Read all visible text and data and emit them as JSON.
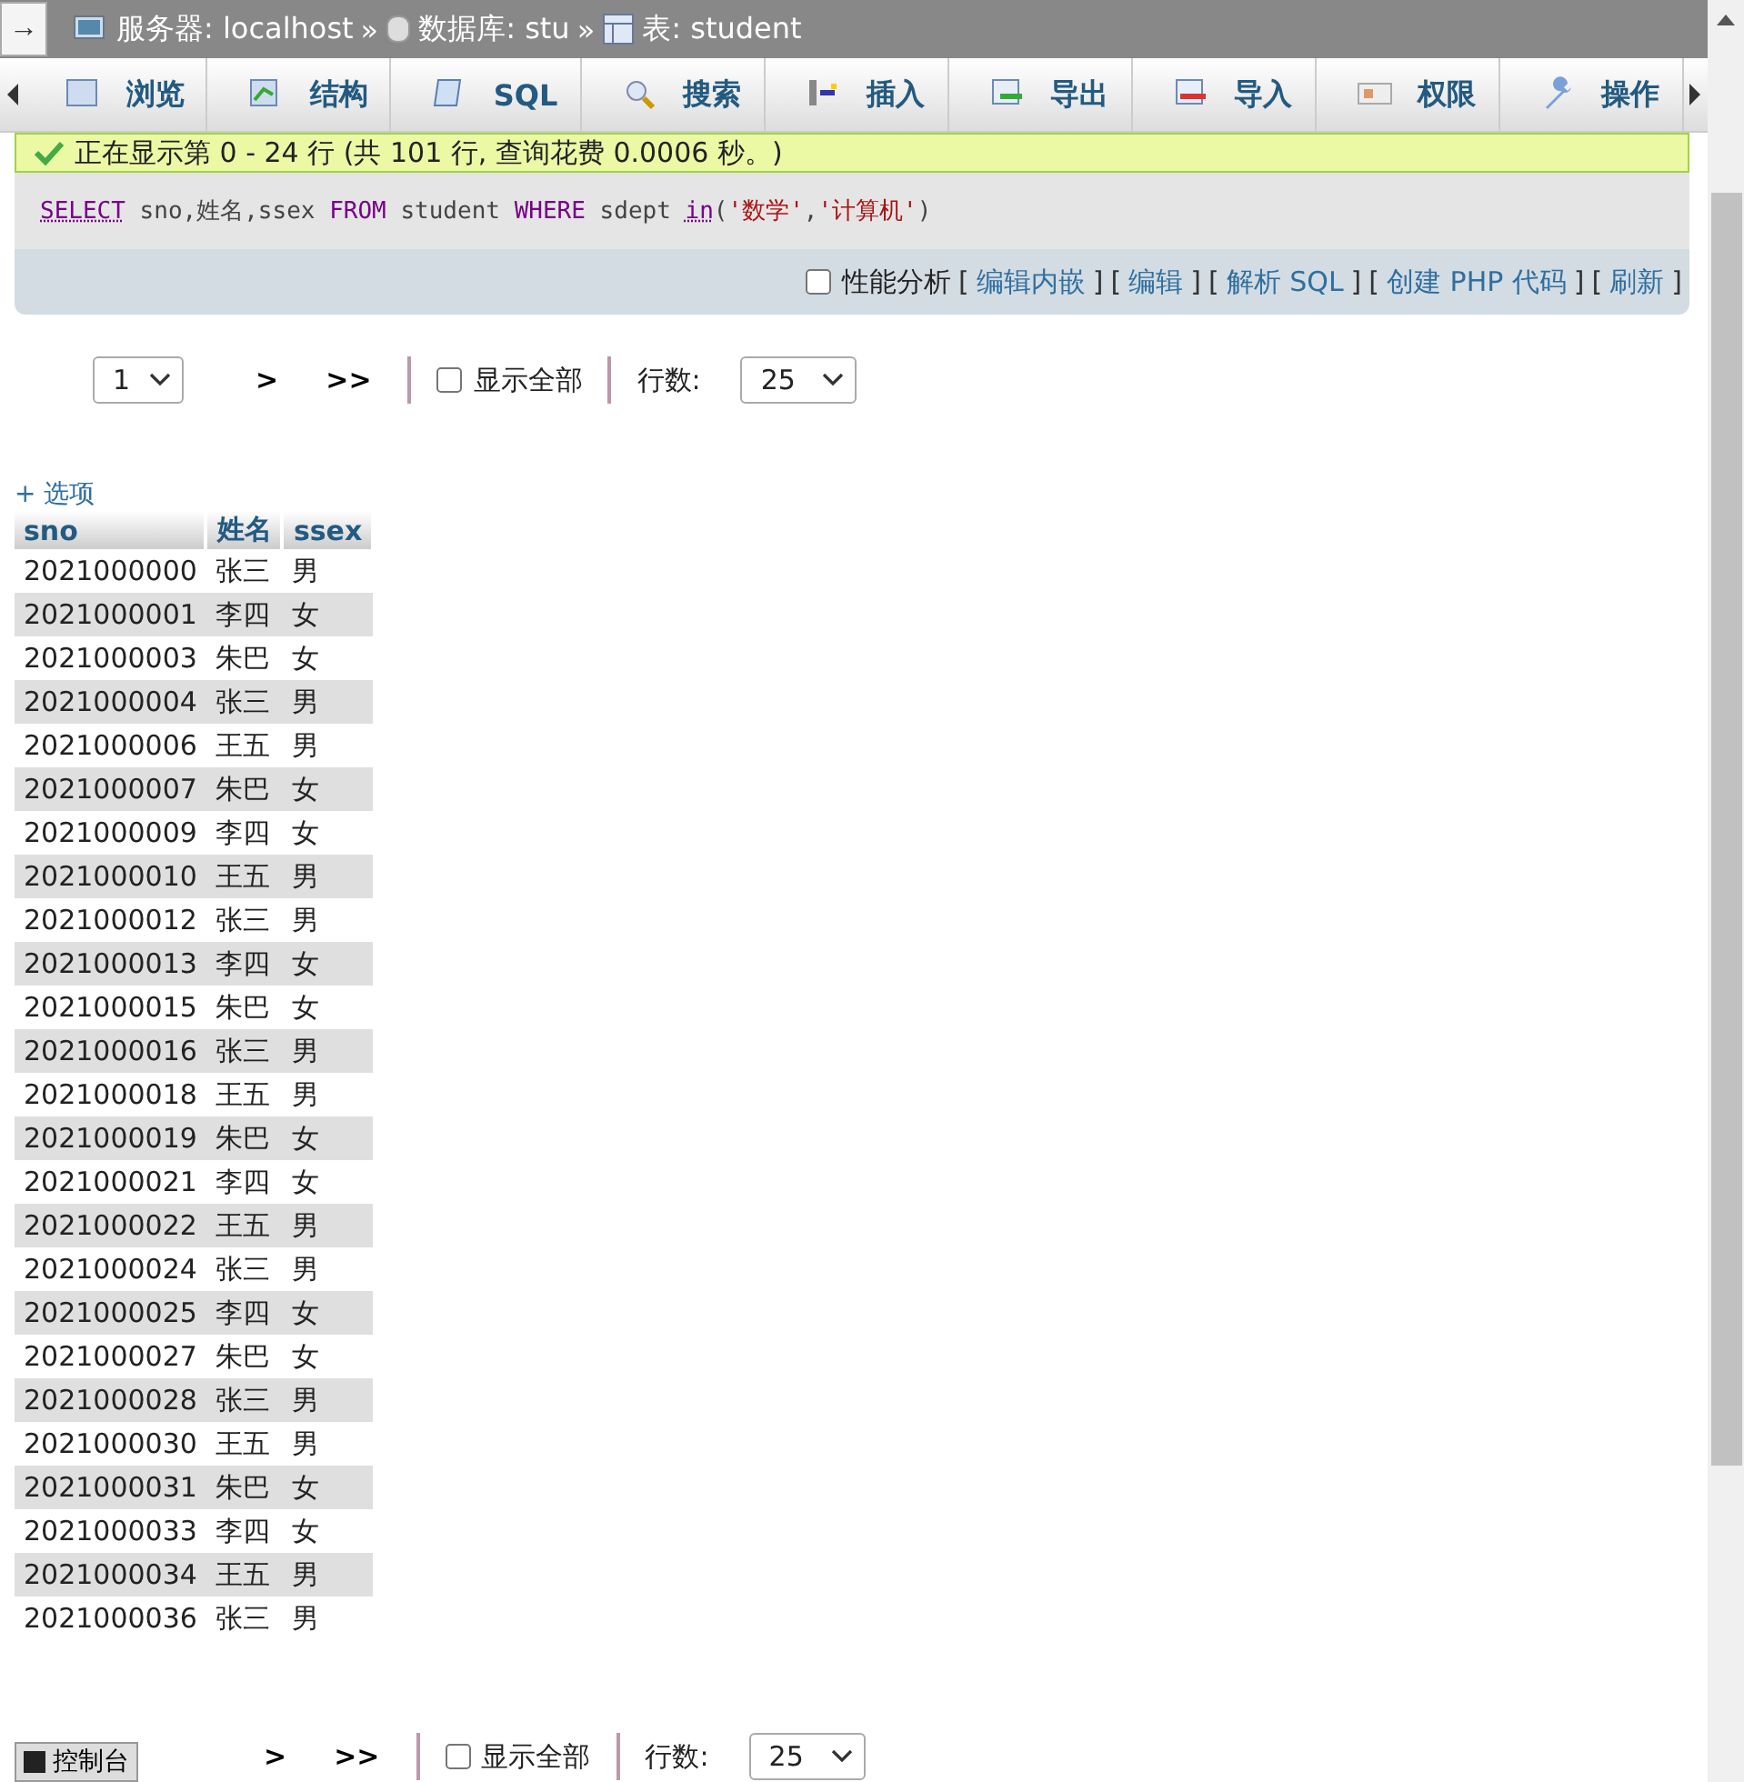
{
  "breadcrumb": [
    {
      "kind": "server",
      "label": "服务器: localhost"
    },
    {
      "kind": "database",
      "label": "数据库: stu"
    },
    {
      "kind": "table",
      "label": "表: student"
    }
  ],
  "breadcrumb_separator": "»",
  "nav_arrow": "→",
  "tabs": [
    {
      "kind": "browse",
      "label": "浏览"
    },
    {
      "kind": "structure",
      "label": "结构"
    },
    {
      "kind": "sql",
      "label": "SQL"
    },
    {
      "kind": "search",
      "label": "搜索"
    },
    {
      "kind": "insert",
      "label": "插入"
    },
    {
      "kind": "export",
      "label": "导出"
    },
    {
      "kind": "import",
      "label": "导入"
    },
    {
      "kind": "privileges",
      "label": "权限"
    },
    {
      "kind": "operations",
      "label": "操作"
    }
  ],
  "notice": "正在显示第 0 - 24 行 (共 101 行, 查询花费 0.0006 秒。)",
  "sql": [
    {
      "kind": "keyword",
      "text": "SELECT"
    },
    {
      "kind": "plain",
      "text": " sno,姓名,ssex "
    },
    {
      "kind": "keyword2",
      "text": "FROM"
    },
    {
      "kind": "plain",
      "text": " student "
    },
    {
      "kind": "keyword2",
      "text": "WHERE"
    },
    {
      "kind": "plain",
      "text": " sdept "
    },
    {
      "kind": "keyword",
      "text": "in"
    },
    {
      "kind": "plain",
      "text": "("
    },
    {
      "kind": "string",
      "text": "'数学'"
    },
    {
      "kind": "plain",
      "text": ","
    },
    {
      "kind": "string",
      "text": "'计算机'"
    },
    {
      "kind": "plain",
      "text": ")"
    }
  ],
  "profiling": {
    "label": "性能分析",
    "checked": false
  },
  "sql_links": [
    {
      "open": "[",
      "text": "编辑内嵌",
      "close": "]"
    },
    {
      "open": "[",
      "text": "编辑",
      "close": "]"
    },
    {
      "open": "[",
      "text": "解析 SQL",
      "close": "]"
    },
    {
      "open": "[",
      "text": "创建 PHP 代码",
      "close": "]"
    },
    {
      "open": "[",
      "text": "刷新",
      "close": "]"
    }
  ],
  "pagination_top": {
    "page": "1",
    "next": ">",
    "last": ">>",
    "show_all": {
      "label": "显示全部",
      "checked": false
    },
    "rows_label": "行数:",
    "rows": "25"
  },
  "pagination_bottom": {
    "next": ">",
    "last": ">>",
    "show_all": {
      "label": "显示全部",
      "checked": false
    },
    "rows_label": "行数:",
    "rows": "25"
  },
  "options_link": "+ 选项",
  "table": {
    "columns": [
      "sno",
      "姓名",
      "ssex"
    ],
    "rows": [
      [
        "2021000000",
        "张三",
        "男"
      ],
      [
        "2021000001",
        "李四",
        "女"
      ],
      [
        "2021000003",
        "朱巴",
        "女"
      ],
      [
        "2021000004",
        "张三",
        "男"
      ],
      [
        "2021000006",
        "王五",
        "男"
      ],
      [
        "2021000007",
        "朱巴",
        "女"
      ],
      [
        "2021000009",
        "李四",
        "女"
      ],
      [
        "2021000010",
        "王五",
        "男"
      ],
      [
        "2021000012",
        "张三",
        "男"
      ],
      [
        "2021000013",
        "李四",
        "女"
      ],
      [
        "2021000015",
        "朱巴",
        "女"
      ],
      [
        "2021000016",
        "张三",
        "男"
      ],
      [
        "2021000018",
        "王五",
        "男"
      ],
      [
        "2021000019",
        "朱巴",
        "女"
      ],
      [
        "2021000021",
        "李四",
        "女"
      ],
      [
        "2021000022",
        "王五",
        "男"
      ],
      [
        "2021000024",
        "张三",
        "男"
      ],
      [
        "2021000025",
        "李四",
        "女"
      ],
      [
        "2021000027",
        "朱巴",
        "女"
      ],
      [
        "2021000028",
        "张三",
        "男"
      ],
      [
        "2021000030",
        "王五",
        "男"
      ],
      [
        "2021000031",
        "朱巴",
        "女"
      ],
      [
        "2021000033",
        "李四",
        "女"
      ],
      [
        "2021000034",
        "王五",
        "男"
      ],
      [
        "2021000036",
        "张三",
        "男"
      ]
    ]
  },
  "console_button": "控制台"
}
